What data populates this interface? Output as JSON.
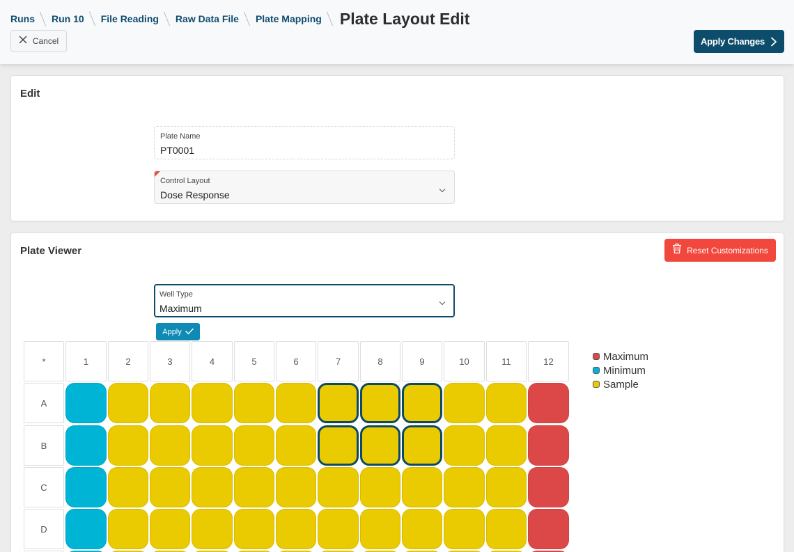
{
  "header": {
    "breadcrumbs": [
      "Runs",
      "Run 10",
      "File Reading",
      "Raw Data File",
      "Plate Mapping"
    ],
    "title": "Plate Layout Edit",
    "cancel_label": "Cancel",
    "apply_changes_label": "Apply Changes"
  },
  "edit_card": {
    "title": "Edit",
    "plate_name": {
      "label": "Plate Name",
      "value": "PT0001"
    },
    "control_layout": {
      "label": "Control Layout",
      "value": "Dose Response"
    }
  },
  "viewer_card": {
    "title": "Plate Viewer",
    "reset_label": "Reset Customizations",
    "well_type": {
      "label": "Well Type",
      "value": "Maximum"
    },
    "apply_label": "Apply"
  },
  "plate": {
    "corner_label": "*",
    "columns": [
      "1",
      "2",
      "3",
      "4",
      "5",
      "6",
      "7",
      "8",
      "9",
      "10",
      "11",
      "12"
    ],
    "rows": [
      "A",
      "B",
      "C",
      "D"
    ],
    "wells": [
      [
        "minimum",
        "sample",
        "sample",
        "sample",
        "sample",
        "sample",
        "sample",
        "sample",
        "sample",
        "sample",
        "sample",
        "maximum"
      ],
      [
        "minimum",
        "sample",
        "sample",
        "sample",
        "sample",
        "sample",
        "sample",
        "sample",
        "sample",
        "sample",
        "sample",
        "maximum"
      ],
      [
        "minimum",
        "sample",
        "sample",
        "sample",
        "sample",
        "sample",
        "sample",
        "sample",
        "sample",
        "sample",
        "sample",
        "maximum"
      ],
      [
        "minimum",
        "sample",
        "sample",
        "sample",
        "sample",
        "sample",
        "sample",
        "sample",
        "sample",
        "sample",
        "sample",
        "maximum"
      ]
    ],
    "selected": [
      [
        0,
        6
      ],
      [
        0,
        7
      ],
      [
        0,
        8
      ],
      [
        1,
        6
      ],
      [
        1,
        7
      ],
      [
        1,
        8
      ]
    ],
    "colors": {
      "maximum": "#dc4848",
      "minimum": "#00b4d6",
      "sample": "#eaca00"
    }
  },
  "legend": [
    {
      "key": "maximum",
      "label": "Maximum",
      "color": "#dc4848"
    },
    {
      "key": "minimum",
      "label": "Minimum",
      "color": "#00b4d6"
    },
    {
      "key": "sample",
      "label": "Sample",
      "color": "#eaca00"
    }
  ],
  "colors": {
    "brand_dark": "#0d4d6b",
    "apply_blue": "#0f8ab5",
    "danger": "#f2473c"
  }
}
